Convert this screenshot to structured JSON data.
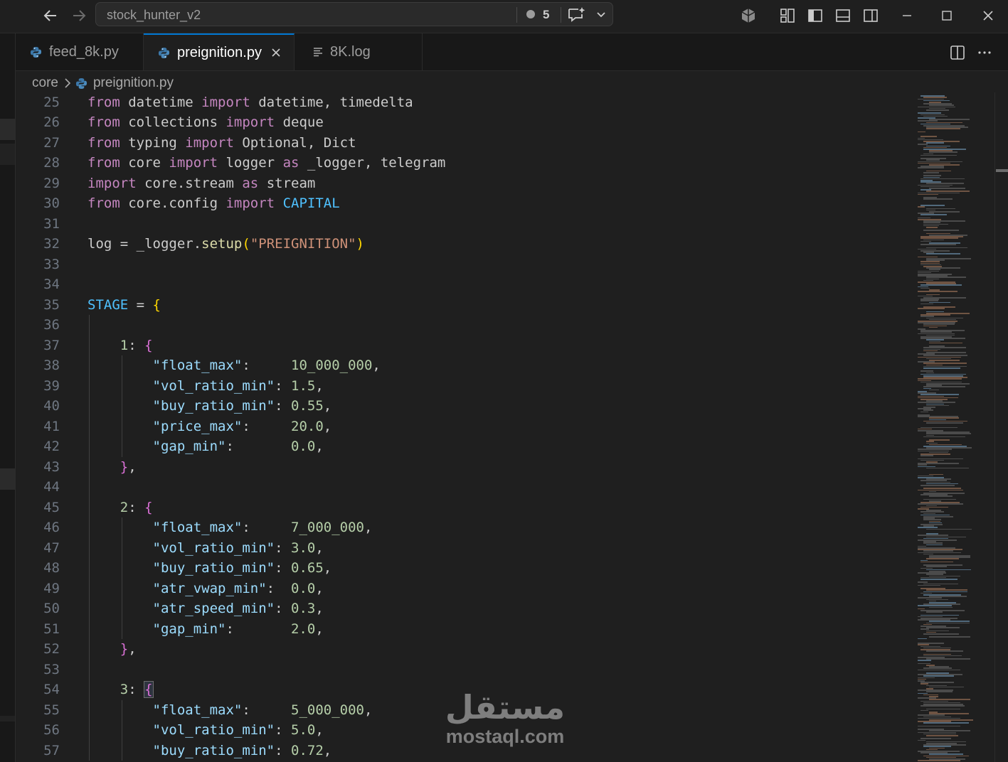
{
  "window": {
    "search_text": "stock_hunter_v2",
    "changes_count": "5"
  },
  "tabs": [
    {
      "label": "feed_8k.py",
      "icon": "python-icon"
    },
    {
      "label": "preignition.py",
      "icon": "python-icon",
      "active": true
    },
    {
      "label": "8K.log",
      "icon": "log-file-icon"
    }
  ],
  "breadcrumb": {
    "folder": "core",
    "file": "preignition.py"
  },
  "code": {
    "line_numbers": [
      "25",
      "26",
      "27",
      "28",
      "29",
      "30",
      "31",
      "32",
      "33",
      "34",
      "35",
      "36",
      "37",
      "38",
      "39",
      "40",
      "41",
      "42",
      "43",
      "44",
      "45",
      "46",
      "47",
      "48",
      "49",
      "50",
      "51",
      "52",
      "53",
      "54",
      "55",
      "56",
      "57"
    ],
    "lines": [
      "from datetime import datetime, timedelta",
      "from collections import deque",
      "from typing import Optional, Dict",
      "from core import logger as _logger, telegram",
      "import core.stream as stream",
      "from core.config import CAPITAL",
      "",
      "log = _logger.setup(\"PREIGNITION\")",
      "",
      "",
      "STAGE = {",
      "",
      "    1: {",
      "        \"float_max\":     10_000_000,",
      "        \"vol_ratio_min\": 1.5,",
      "        \"buy_ratio_min\": 0.55,",
      "        \"price_max\":     20.0,",
      "        \"gap_min\":       0.0,",
      "    },",
      "",
      "    2: {",
      "        \"float_max\":     7_000_000,",
      "        \"vol_ratio_min\": 3.0,",
      "        \"buy_ratio_min\": 0.65,",
      "        \"atr_vwap_min\":  0.0,",
      "        \"atr_speed_min\": 0.3,",
      "        \"gap_min\":       2.0,",
      "    },",
      "",
      "    3: {",
      "        \"float_max\":     5_000_000,",
      "        \"vol_ratio_min\": 5.0,",
      "        \"buy_ratio_min\": 0.72,"
    ]
  },
  "watermark": {
    "arabic": "مستقل",
    "latin": "mostaql.com"
  }
}
